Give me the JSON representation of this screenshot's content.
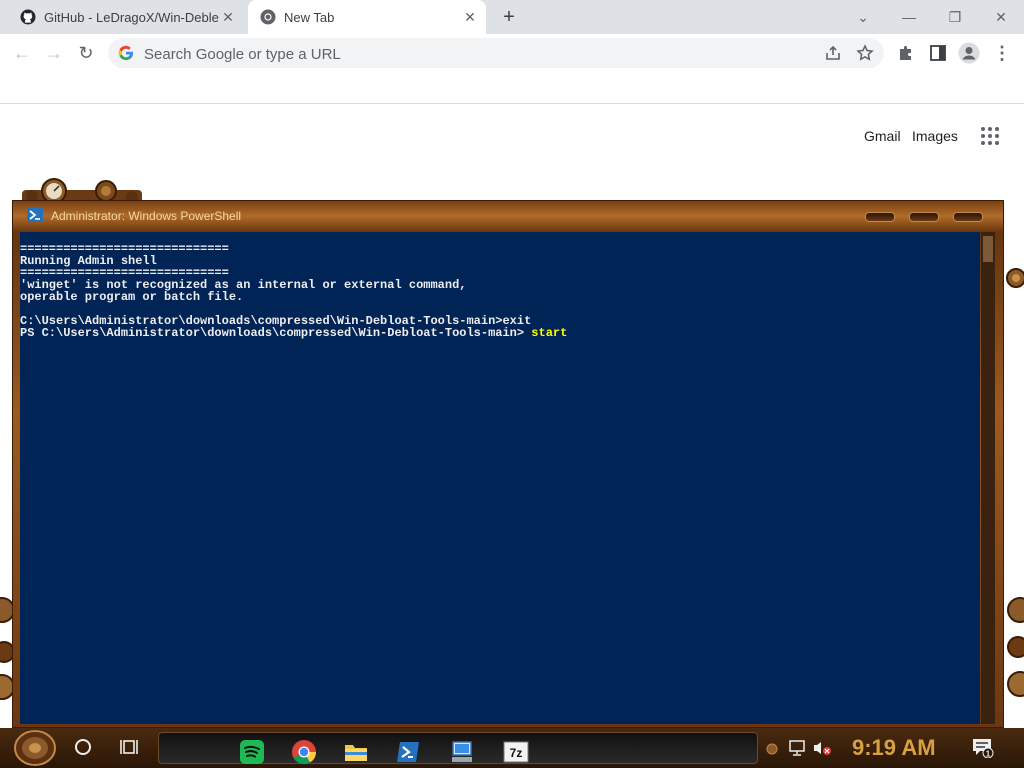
{
  "browser": {
    "tabs": [
      {
        "title": "GitHub - LeDragoX/Win-Deble",
        "close": "✕",
        "icon": "github-icon"
      },
      {
        "title": "New Tab",
        "close": "✕",
        "icon": "chrome-icon"
      }
    ],
    "new_tab_symbol": "+",
    "window_controls": {
      "dropdown": "⌄",
      "minimize": "—",
      "restore": "❐",
      "close": "✕"
    },
    "toolbar": {
      "back": "←",
      "forward": "→",
      "reload": "↻",
      "omnibox_placeholder": "Search Google or type a URL",
      "menu": "⋮"
    }
  },
  "ntp": {
    "gmail": "Gmail",
    "images": "Images"
  },
  "powershell": {
    "title": "Administrator: Windows PowerShell",
    "console": {
      "lines": [
        "=============================",
        "Running Admin shell",
        "=============================",
        "'winget' is not recognized as an internal or external command,",
        "operable program or batch file.",
        "",
        "C:\\Users\\Administrator\\downloads\\compressed\\Win-Debloat-Tools-main>exit",
        "PS C:\\Users\\Administrator\\downloads\\compressed\\Win-Debloat-Tools-main> "
      ],
      "typed_command": "start"
    }
  },
  "taskbar": {
    "clock": "9:19 AM",
    "pinned": [
      "spotify-icon",
      "chrome-icon",
      "file-explorer-icon",
      "powershell-icon",
      "remote-desktop-icon",
      "7zip-icon"
    ],
    "sevenzip_label": "7z",
    "notification_count": "1"
  },
  "colors": {
    "console_bg": "#012456",
    "console_text": "#eeedf0",
    "command_text": "#ffff00",
    "frame_brown": "#9c5a20",
    "clock": "#d8a040"
  }
}
